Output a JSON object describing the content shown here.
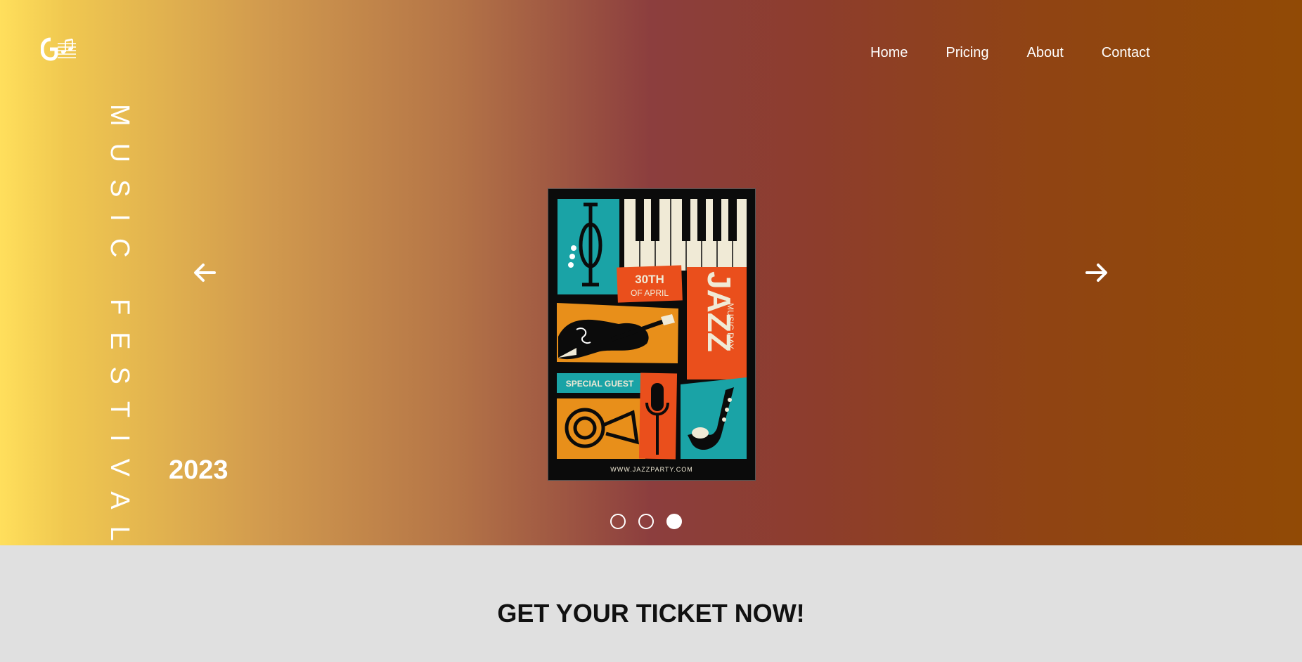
{
  "nav": {
    "items": [
      "Home",
      "Pricing",
      "About",
      "Contact"
    ]
  },
  "hero": {
    "vertical_title": "MUSIC FESTIVAL",
    "year": "2023",
    "poster": {
      "date_line1": "30TH",
      "date_line2": "OF APRIL",
      "title": "JAZZ",
      "subtitle": "MUSIC DAY",
      "special": "SPECIAL GUEST",
      "url": "WWW.JAZZPARTY.COM"
    },
    "carousel": {
      "slides": 3,
      "active": 3
    }
  },
  "cta": {
    "heading": "GET YOUR TICKET NOW!"
  },
  "colors": {
    "poster_teal": "#1aa3a6",
    "poster_orange": "#e88f1a",
    "poster_red": "#ea4f1c",
    "poster_cream": "#f0ead6"
  }
}
